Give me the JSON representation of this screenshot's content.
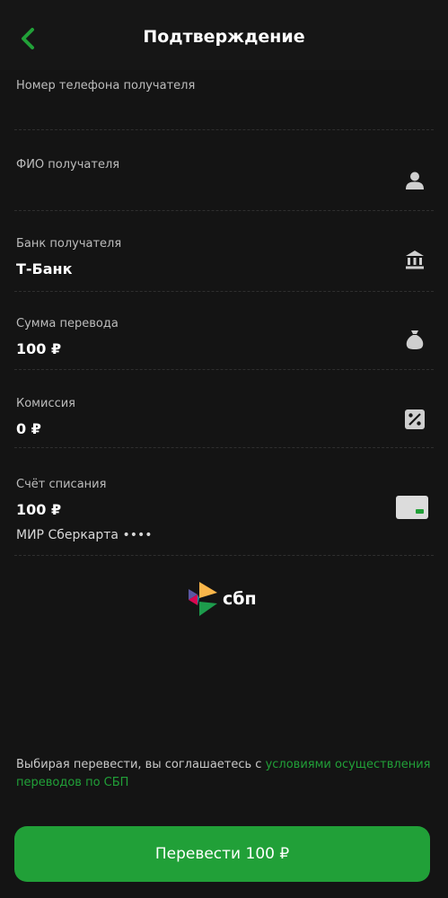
{
  "header": {
    "title": "Подтверждение",
    "back_icon": "chevron-left-icon"
  },
  "fields": {
    "recipient_phone": {
      "label": "Номер телефона получателя"
    },
    "recipient_name": {
      "label": "ФИО получателя",
      "icon": "person-icon"
    },
    "recipient_bank": {
      "label": "Банк получателя",
      "value": "Т-Банк",
      "icon": "bank-icon"
    },
    "amount": {
      "label": "Сумма перевода",
      "value": "100 ₽",
      "icon": "money-bag-icon"
    },
    "commission": {
      "label": "Комиссия",
      "value": "0 ₽",
      "icon": "percent-icon"
    },
    "debit_account": {
      "label": "Счёт списания",
      "value": "100 ₽",
      "sub": "МИР Сберкарта ••••",
      "icon": "card-icon"
    }
  },
  "sbp": {
    "logo_text": "сбп"
  },
  "agreement": {
    "text": "Выбирая перевести, вы соглашаетесь с ",
    "link": "условиями осуществления переводов по СБП"
  },
  "pay_button": {
    "label": "Перевести 100 ₽"
  },
  "colors": {
    "background": "#141414",
    "accent": "#21a038",
    "text_secondary": "#bdbdbd"
  }
}
